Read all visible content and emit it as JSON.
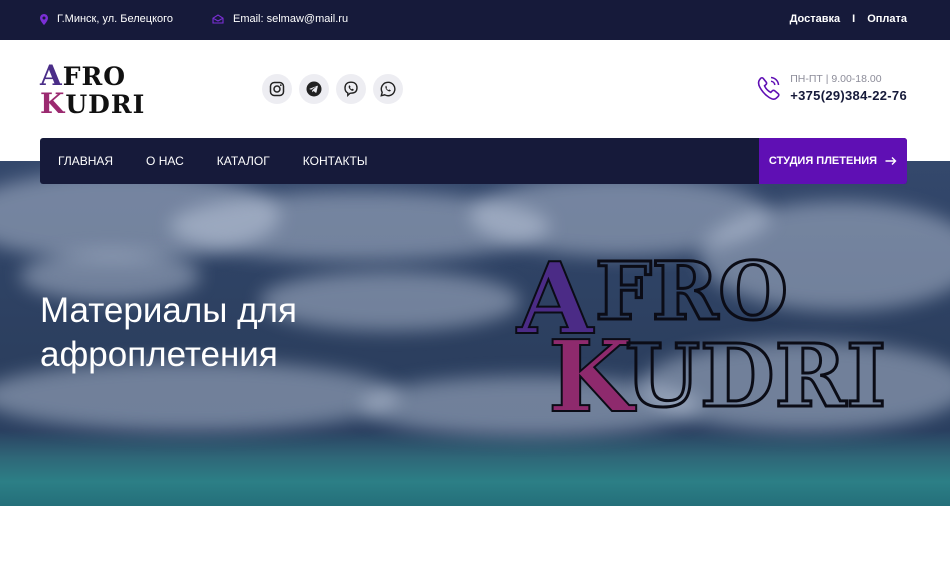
{
  "topbar": {
    "address": "Г.Минск, ул. Белецкого",
    "email": "Email: selmaw@mail.ru",
    "links": [
      "Доставка",
      "Оплата"
    ],
    "separator": "I"
  },
  "logo": {
    "line1": "AFRO",
    "line2": "KUDRI"
  },
  "socials": [
    "instagram-icon",
    "telegram-icon",
    "viber-icon",
    "whatsapp-icon"
  ],
  "contact": {
    "hours": "ПН-ПТ | 9.00-18.00",
    "phone": "+375(29)384-22-76"
  },
  "nav": {
    "items": [
      "ГЛАВНАЯ",
      "О НАС",
      "КАТАЛОГ",
      "КОНТАКТЫ"
    ],
    "cta": "СТУДИЯ ПЛЕТЕНИЯ"
  },
  "hero": {
    "title_line1": "Материалы для",
    "title_line2": "афроплетения"
  },
  "colors": {
    "dark": "#161a3a",
    "accent": "#5f0fb4",
    "logo_purple": "#4a2d88",
    "logo_pink": "#9b2a70"
  }
}
